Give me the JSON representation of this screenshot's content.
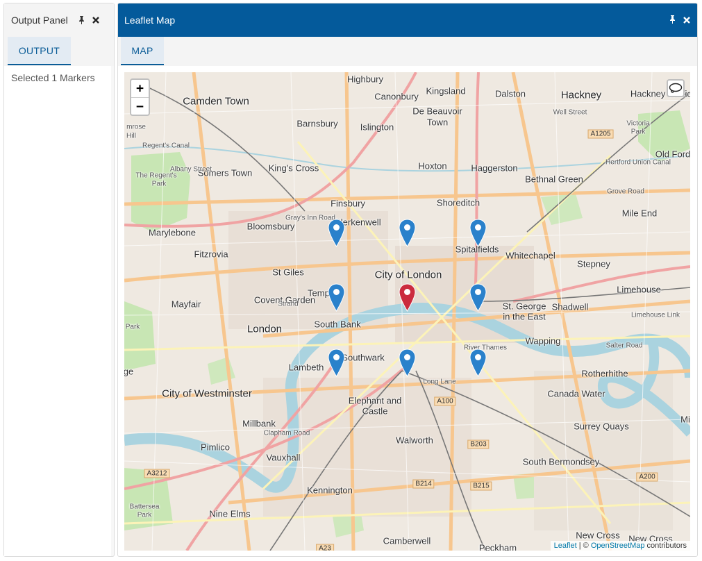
{
  "output_panel": {
    "title": "Output Panel",
    "tab_label": "OUTPUT",
    "message": "Selected 1 Markers"
  },
  "map_panel": {
    "title": "Leaflet Map",
    "tab_label": "MAP",
    "zoom_in": "+",
    "zoom_out": "−",
    "attribution": {
      "leaflet": "Leaflet",
      "sep": " | © ",
      "osm": "OpenStreetMap",
      "suffix": " contributors"
    },
    "marker_colors": {
      "blue": "#2a81cb",
      "red": "#cb2b3e"
    },
    "markers": [
      {
        "color": "blue"
      },
      {
        "color": "blue"
      },
      {
        "color": "blue"
      },
      {
        "color": "blue"
      },
      {
        "color": "red"
      },
      {
        "color": "blue"
      },
      {
        "color": "blue"
      },
      {
        "color": "blue"
      },
      {
        "color": "blue"
      }
    ],
    "places": {
      "highbury": "Highbury",
      "canonbury": "Canonbury",
      "kingsland": "Kingsland",
      "dalston": "Dalston",
      "hackney": "Hackney",
      "hackney_wick": "Hackney Wick",
      "camden_town": "Camden Town",
      "de_beauvoir": "De Beauvoir",
      "de_beauvoir2": "Town",
      "barnsbury": "Barnsbury",
      "islington": "Islington",
      "primrose": "mrose",
      "primrose2": "Hill",
      "victoria_park": "Victoria",
      "victoria_park2": "Park",
      "old_ford": "Old Ford",
      "somers_town": "Somers Town",
      "kings_cross": "King's Cross",
      "hoxton": "Hoxton",
      "haggerston": "Haggerston",
      "regents_park": "The Regent's",
      "regents_park2": "Park",
      "bethnal_green": "Bethnal Green",
      "finsbury": "Finsbury",
      "shoreditch": "Shoreditch",
      "mile_end": "Mile End",
      "marylebone": "Marylebone",
      "bloomsbury": "Bloomsbury",
      "clerkenwell": "Clerkenwell",
      "spitalfields": "Spitalfields",
      "fitzrovia": "Fitzrovia",
      "whitechapel": "Whitechapel",
      "stepney": "Stepney",
      "st_giles": "St Giles",
      "city_of_london": "City of London",
      "limehouse": "Limehouse",
      "mayfair": "Mayfair",
      "covent_garden": "Covent Garden",
      "temple": "Temple",
      "st_george": "St. George",
      "st_george2": "in the East",
      "shadwell": "Shadwell",
      "london": "London",
      "south_bank": "South Bank",
      "park": "Park",
      "wapping": "Wapping",
      "lambeth": "Lambeth",
      "southwark": "Southwark",
      "rotherhithe": "Rotherhithe",
      "city_of_westminster": "City of Westminster",
      "elephant": "Elephant and",
      "elephant2": "Castle",
      "canada_water": "Canada Water",
      "millbank": "Millbank",
      "surrey_quays": "Surrey Quays",
      "walworth": "Walworth",
      "pimlico": "Pimlico",
      "vauxhall": "Vauxhall",
      "south_bermondsey": "South Bermondsey",
      "kennington": "Kennington",
      "battersea": "Battersea",
      "battersea2": "Park",
      "nine_elms": "Nine Elms",
      "camberwell": "Camberwell",
      "peckham": "Peckham",
      "new_cross": "New Cross",
      "new_cross2": "New Cross",
      "edge_ge": "ge",
      "mi": "Mi",
      "hackney_vic": "Vic"
    },
    "roads": {
      "a1205": "A1205",
      "a100": "A100",
      "b203": "B203",
      "a3212": "A3212",
      "b214": "B214",
      "b215": "B215",
      "a200": "A200",
      "a23": "A23"
    },
    "street_labels": {
      "well_street": "Well Street",
      "grays_inn": "Gray's Inn Road",
      "strand": "Strand",
      "long_lane": "Long Lane",
      "river_thames": "River Thames",
      "albany": "Albany Street",
      "clapham": "Clapham Road",
      "salter": "Salter Road",
      "lime_link": "Limehouse Link",
      "grove_road": "Grove Road",
      "union_canal": "Hertford Union Canal",
      "regents_canal": "Regent's Canal"
    }
  }
}
